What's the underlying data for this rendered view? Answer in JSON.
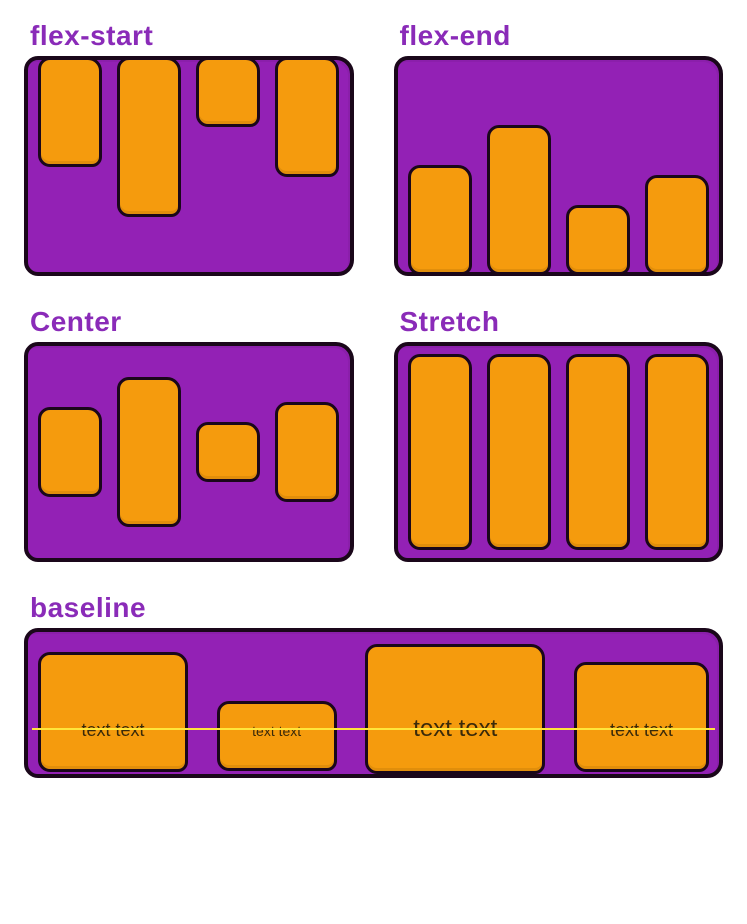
{
  "panels": {
    "flex_start": {
      "label": "flex-start"
    },
    "flex_end": {
      "label": "flex-end"
    },
    "center": {
      "label": "Center"
    },
    "stretch": {
      "label": "Stretch"
    },
    "baseline": {
      "label": "baseline",
      "items": [
        {
          "caption": "text text"
        },
        {
          "caption": "text text"
        },
        {
          "caption": "text text"
        },
        {
          "caption": "text text"
        }
      ]
    }
  },
  "colors": {
    "container": "#9321b5",
    "item": "#f59b0d",
    "label": "#8a2bb8",
    "baseline_rule": "#ffe63b"
  }
}
